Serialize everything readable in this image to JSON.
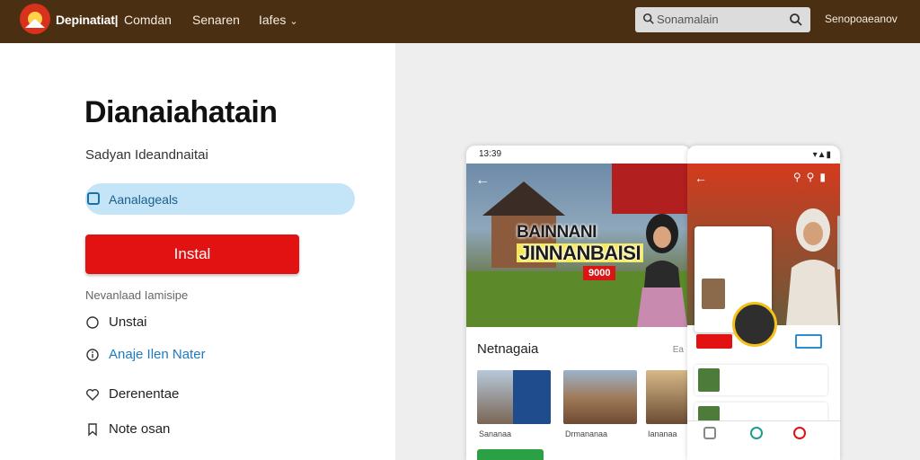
{
  "header": {
    "brand": "Depinatiat|",
    "nav": [
      {
        "label": "Comdan"
      },
      {
        "label": "Senaren"
      },
      {
        "label": "Iafes"
      }
    ],
    "search": {
      "placeholder": "Sonamalain"
    },
    "user_menu": "Senopoaeanov"
  },
  "main": {
    "title": "Dianaiahatain",
    "subtitle": "Sadyan Ideandnaitai",
    "option": {
      "label": "Aanalageals"
    },
    "install_label": "Instal",
    "section_label": "Nevanlaad Iamisipe",
    "items": [
      {
        "label": "Unstai",
        "icon": "radio-icon"
      },
      {
        "label": "Anaje Ilen Nater",
        "icon": "info-icon"
      },
      {
        "label": "Derenentae",
        "icon": "heart-icon"
      },
      {
        "label": "Note osan",
        "icon": "bookmark-icon"
      }
    ]
  },
  "preview": {
    "phone_a": {
      "time": "13:39",
      "banner_line1": "BAINNANI",
      "banner_line2": "JINNANBAISI",
      "banner_tag": "9000",
      "section_title": "Netnagaia",
      "section_more": "Ea",
      "captions": [
        "Sananaa",
        "Drmananaa",
        "Iananaa"
      ]
    },
    "phone_b": {}
  },
  "colors": {
    "topbar": "#4a2f12",
    "accent_red": "#e21212",
    "pill_blue": "#c4e5f7",
    "link_blue": "#1c7bc0"
  }
}
